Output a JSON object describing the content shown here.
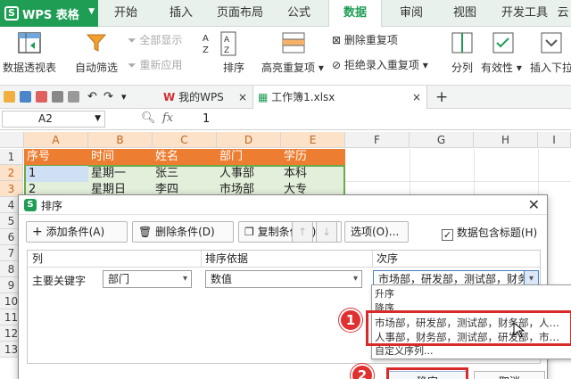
{
  "app": {
    "name": "WPS 表格"
  },
  "ribbon_tabs": [
    "开始",
    "插入",
    "页面布局",
    "公式",
    "数据",
    "审阅",
    "视图",
    "开发工具",
    "云"
  ],
  "active_tab": "数据",
  "ribbon": {
    "pivot": "数据透视表",
    "autofilter": "自动筛选",
    "show_all": "全部显示",
    "reapply": "重新应用",
    "sort": "排序",
    "highlight_dup": "高亮重复项",
    "delete_dup": "删除重复项",
    "reject_dup": "拒绝录入重复项",
    "split": "分列",
    "validity": "有效性",
    "insert_dropdown": "插入下拉"
  },
  "doc_tabs": {
    "my_wps": "我的WPS",
    "workbook": "工作簿1.xlsx"
  },
  "formula_bar": {
    "cell_ref": "A2",
    "fx": "fx",
    "value": "1"
  },
  "columns": [
    "A",
    "B",
    "C",
    "D",
    "E",
    "F",
    "G",
    "H",
    "I"
  ],
  "rows": [
    "1",
    "2",
    "3",
    "4",
    "5",
    "6",
    "7",
    "8",
    "9",
    "10",
    "11",
    "12",
    "13"
  ],
  "table": {
    "headers": [
      "序号",
      "时间",
      "姓名",
      "部门",
      "学历"
    ],
    "row1": [
      "1",
      "星期一",
      "张三",
      "人事部",
      "本科"
    ],
    "row2": [
      "2",
      "星期日",
      "李四",
      "市场部",
      "大专"
    ]
  },
  "dialog": {
    "title": "排序",
    "add_condition": "添加条件(A)",
    "delete_condition": "删除条件(D)",
    "copy_condition": "复制条件(C)",
    "options": "选项(O)...",
    "header_checkbox": "数据包含标题(H)",
    "col_header": "列",
    "sort_basis_header": "排序依据",
    "order_header": "次序",
    "primary_key": "主要关键字",
    "column_value": "部门",
    "basis_value": "数值",
    "order_value": "市场部，研发部，测试部，财务",
    "ok": "确定",
    "cancel": "取消"
  },
  "dropdown": {
    "ascending": "升序",
    "descending": "降序",
    "opt1": "市场部，研发部，测试部，财务部，人…",
    "opt2": "人事部，财务部，测试部，研发部，市…",
    "custom": "自定义序列..."
  },
  "annotations": {
    "badge1": "1",
    "badge2": "2"
  },
  "colors": {
    "accent": "#1f9d55",
    "header_fill": "#ed7d31",
    "highlight": "#d92a2a"
  }
}
